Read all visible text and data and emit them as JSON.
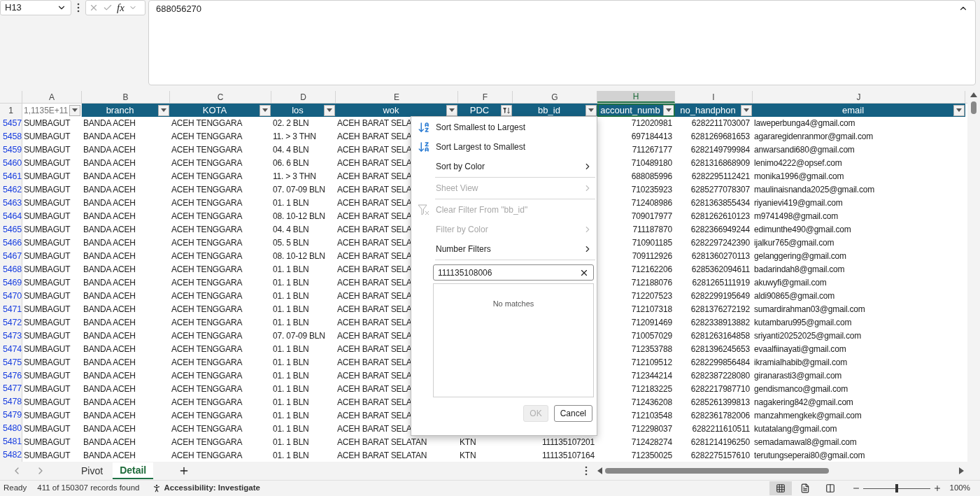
{
  "formula_bar": {
    "name_box": "H13",
    "fx": "fx",
    "formula": "688056270"
  },
  "columns": [
    {
      "letter": "A",
      "header": "1,1135E+11",
      "kind": "plain",
      "selected": false,
      "filtered": false
    },
    {
      "letter": "B",
      "header": "branch",
      "kind": "field",
      "selected": false,
      "filtered": false
    },
    {
      "letter": "C",
      "header": "KOTA",
      "kind": "field",
      "selected": false,
      "filtered": false
    },
    {
      "letter": "D",
      "header": "los",
      "kind": "field",
      "selected": false,
      "filtered": false
    },
    {
      "letter": "E",
      "header": "wok",
      "kind": "field",
      "selected": false,
      "filtered": false
    },
    {
      "letter": "F",
      "header": "PDC",
      "kind": "field",
      "selected": false,
      "filtered": true
    },
    {
      "letter": "G",
      "header": "bb_id",
      "kind": "field",
      "selected": false,
      "filtered": false
    },
    {
      "letter": "H",
      "header": "account_numb",
      "kind": "field",
      "selected": true,
      "filtered": false
    },
    {
      "letter": "I",
      "header": "no_handphon",
      "kind": "field",
      "selected": false,
      "filtered": false
    },
    {
      "letter": "J",
      "header": "email",
      "kind": "field",
      "selected": false,
      "filtered": false
    }
  ],
  "header_row": "1",
  "rows": [
    {
      "row": "5457",
      "cells": [
        "SUMBAGUT",
        "BANDA ACEH",
        "ACEH TENGGARA",
        "02. 2 BLN",
        "ACEH BARAT SELA",
        null,
        null,
        "712020981",
        "6282211703007",
        "laweperbunga4@gmail.com"
      ]
    },
    {
      "row": "5458",
      "cells": [
        "SUMBAGUT",
        "BANDA ACEH",
        "ACEH TENGGARA",
        "11. > 3 THN",
        "ACEH BARAT SELA",
        null,
        null,
        "697184413",
        "6281269681653",
        "agararegidenranmor@gmail.com"
      ]
    },
    {
      "row": "5459",
      "cells": [
        "SUMBAGUT",
        "BANDA ACEH",
        "ACEH TENGGARA",
        "04. 4 BLN",
        "ACEH BARAT SELA",
        null,
        null,
        "711267177",
        "6282149799984",
        "anwarsandi680@gmail.com"
      ]
    },
    {
      "row": "5460",
      "cells": [
        "SUMBAGUT",
        "BANDA ACEH",
        "ACEH TENGGARA",
        "06. 6 BLN",
        "ACEH BARAT SELA",
        null,
        null,
        "710489180",
        "6281316868909",
        "lenimo4222@opsef.com"
      ]
    },
    {
      "row": "5461",
      "cells": [
        "SUMBAGUT",
        "BANDA ACEH",
        "ACEH TENGGARA",
        "11. > 3 THN",
        "ACEH BARAT SELA",
        null,
        null,
        "688085996",
        "6282295112421",
        "monika1996@gmail.com"
      ]
    },
    {
      "row": "5462",
      "cells": [
        "SUMBAGUT",
        "BANDA ACEH",
        "ACEH TENGGARA",
        "07. 07-09 BLN",
        "ACEH BARAT SELA",
        null,
        null,
        "710235923",
        "6285277078307",
        "maulinaisnanda2025@gmail.com"
      ]
    },
    {
      "row": "5463",
      "cells": [
        "SUMBAGUT",
        "BANDA ACEH",
        "ACEH TENGGARA",
        "01. 1 BLN",
        "ACEH BARAT SELA",
        null,
        null,
        "712408986",
        "6281363855434",
        "riyanievi419@gmail.com"
      ]
    },
    {
      "row": "5464",
      "cells": [
        "SUMBAGUT",
        "BANDA ACEH",
        "ACEH TENGGARA",
        "08. 10-12 BLN",
        "ACEH BARAT SELA",
        null,
        null,
        "709017977",
        "6281262610123",
        "m9741498@gmail.com"
      ]
    },
    {
      "row": "5465",
      "cells": [
        "SUMBAGUT",
        "BANDA ACEH",
        "ACEH TENGGARA",
        "04. 4 BLN",
        "ACEH BARAT SELA",
        null,
        null,
        "711187870",
        "6282366949244",
        "edimunthe490@gmail.com"
      ]
    },
    {
      "row": "5466",
      "cells": [
        "SUMBAGUT",
        "BANDA ACEH",
        "ACEH TENGGARA",
        "05. 5 BLN",
        "ACEH BARAT SELA",
        null,
        null,
        "710901185",
        "6282297242390",
        "ijalkur765@gmail.com"
      ]
    },
    {
      "row": "5467",
      "cells": [
        "SUMBAGUT",
        "BANDA ACEH",
        "ACEH TENGGARA",
        "08. 10-12 BLN",
        "ACEH BARAT SELA",
        null,
        null,
        "709112926",
        "6281360270113",
        "gelanggering@gmail.com"
      ]
    },
    {
      "row": "5468",
      "cells": [
        "SUMBAGUT",
        "BANDA ACEH",
        "ACEH TENGGARA",
        "01. 1 BLN",
        "ACEH BARAT SELA",
        null,
        null,
        "712162206",
        "6285362094611",
        "badarindah8@gmail.com"
      ]
    },
    {
      "row": "5469",
      "cells": [
        "SUMBAGUT",
        "BANDA ACEH",
        "ACEH TENGGARA",
        "01. 1 BLN",
        "ACEH BARAT SELA",
        null,
        null,
        "712188076",
        "6281265111919",
        "akuwyfi@gmail.com"
      ]
    },
    {
      "row": "5470",
      "cells": [
        "SUMBAGUT",
        "BANDA ACEH",
        "ACEH TENGGARA",
        "01. 1 BLN",
        "ACEH BARAT SELA",
        null,
        null,
        "712207523",
        "6282299195649",
        "aldi90865@gmail.com"
      ]
    },
    {
      "row": "5471",
      "cells": [
        "SUMBAGUT",
        "BANDA ACEH",
        "ACEH TENGGARA",
        "01. 1 BLN",
        "ACEH BARAT SELA",
        null,
        null,
        "712107318",
        "6281376272192",
        "sumardirahman03@gmail.com"
      ]
    },
    {
      "row": "5472",
      "cells": [
        "SUMBAGUT",
        "BANDA ACEH",
        "ACEH TENGGARA",
        "01. 1 BLN",
        "ACEH BARAT SELA",
        null,
        null,
        "712091469",
        "6282338913882",
        "kutambaru995@gmail.com"
      ]
    },
    {
      "row": "5473",
      "cells": [
        "SUMBAGUT",
        "BANDA ACEH",
        "ACEH TENGGARA",
        "07. 07-09 BLN",
        "ACEH BARAT SELA",
        null,
        null,
        "710057029",
        "6281263164858",
        "sriyanti20252025@gmail.com"
      ]
    },
    {
      "row": "5474",
      "cells": [
        "SUMBAGUT",
        "BANDA ACEH",
        "ACEH TENGGARA",
        "01. 1 BLN",
        "ACEH BARAT SELA",
        null,
        null,
        "712353788",
        "6281396245653",
        "evaalfiinayati@gmail.com"
      ]
    },
    {
      "row": "5475",
      "cells": [
        "SUMBAGUT",
        "BANDA ACEH",
        "ACEH TENGGARA",
        "01. 1 BLN",
        "ACEH BARAT SELA",
        null,
        null,
        "712109512",
        "6282299856484",
        "ikramialhabib@gmail.com"
      ]
    },
    {
      "row": "5476",
      "cells": [
        "SUMBAGUT",
        "BANDA ACEH",
        "ACEH TENGGARA",
        "01. 1 BLN",
        "ACEH BARAT SELA",
        null,
        null,
        "712344214",
        "6282387228080",
        "giranarasti3@gmail.com"
      ]
    },
    {
      "row": "5477",
      "cells": [
        "SUMBAGUT",
        "BANDA ACEH",
        "ACEH TENGGARA",
        "01. 1 BLN",
        "ACEH BARAT SELA",
        null,
        null,
        "712183225",
        "6282217987710",
        "gendismanco@gmail.com"
      ]
    },
    {
      "row": "5478",
      "cells": [
        "SUMBAGUT",
        "BANDA ACEH",
        "ACEH TENGGARA",
        "01. 1 BLN",
        "ACEH BARAT SELA",
        null,
        null,
        "712436208",
        "6285261399813",
        "nagakering842@gmail.com"
      ]
    },
    {
      "row": "5479",
      "cells": [
        "SUMBAGUT",
        "BANDA ACEH",
        "ACEH TENGGARA",
        "01. 1 BLN",
        "ACEH BARAT SELA",
        null,
        null,
        "712103548",
        "6282361782006",
        "manzahmengkek@gmail.com"
      ]
    },
    {
      "row": "5480",
      "cells": [
        "SUMBAGUT",
        "BANDA ACEH",
        "ACEH TENGGARA",
        "01. 1 BLN",
        "ACEH BARAT SELA",
        null,
        null,
        "712298037",
        "6282211610511",
        "kutatalang@gmail.com"
      ]
    },
    {
      "row": "5481",
      "cells": [
        "SUMBAGUT",
        "BANDA ACEH",
        "ACEH TENGGARA",
        "01. 1 BLN",
        "ACEH BARAT SELATAN",
        "KTN",
        "111135107201",
        "712428274",
        "6281214196250",
        "semadamawal8@gmail.com"
      ]
    },
    {
      "row": "5482",
      "cells": [
        "SUMBAGUT",
        "BANDA ACEH",
        "ACEH TENGGARA",
        "01. 1 BLN",
        "ACEH BARAT SELATAN",
        "KTN",
        "111135107164",
        "712350025",
        "6282275157610",
        "terutungseperai80@gmail.com"
      ]
    }
  ],
  "filter_menu": {
    "items": [
      {
        "kind": "sort-asc",
        "label": "Sort Smallest to Largest",
        "disabled": false,
        "submenu": false
      },
      {
        "kind": "sort-desc",
        "label": "Sort Largest to Smallest",
        "disabled": false,
        "submenu": false
      },
      {
        "kind": "item",
        "label": "Sort by Color",
        "disabled": false,
        "submenu": true
      },
      {
        "kind": "separator"
      },
      {
        "kind": "item",
        "label": "Sheet View",
        "disabled": true,
        "submenu": true
      },
      {
        "kind": "separator"
      },
      {
        "kind": "clear-filter",
        "label": "Clear Filter From \"bb_id\"",
        "disabled": true,
        "submenu": false
      },
      {
        "kind": "item",
        "label": "Filter by Color",
        "disabled": true,
        "submenu": true
      },
      {
        "kind": "item",
        "label": "Number Filters",
        "disabled": false,
        "submenu": true
      },
      {
        "kind": "separator"
      }
    ],
    "search": {
      "value": "111135108006"
    },
    "message": "No matches",
    "buttons": [
      {
        "label": "OK",
        "disabled": true
      },
      {
        "label": "Cancel",
        "disabled": false
      }
    ]
  },
  "sheet_tabs": [
    {
      "label": "Pivot",
      "selected": false
    },
    {
      "label": "Detail",
      "selected": true
    }
  ],
  "status_bar": {
    "mode": "Ready",
    "records": "411 of 150307 records found",
    "accessibility": "Accessibility: Investigate",
    "zoom_slider": {
      "level": 0.5
    },
    "zoom": "100%"
  }
}
